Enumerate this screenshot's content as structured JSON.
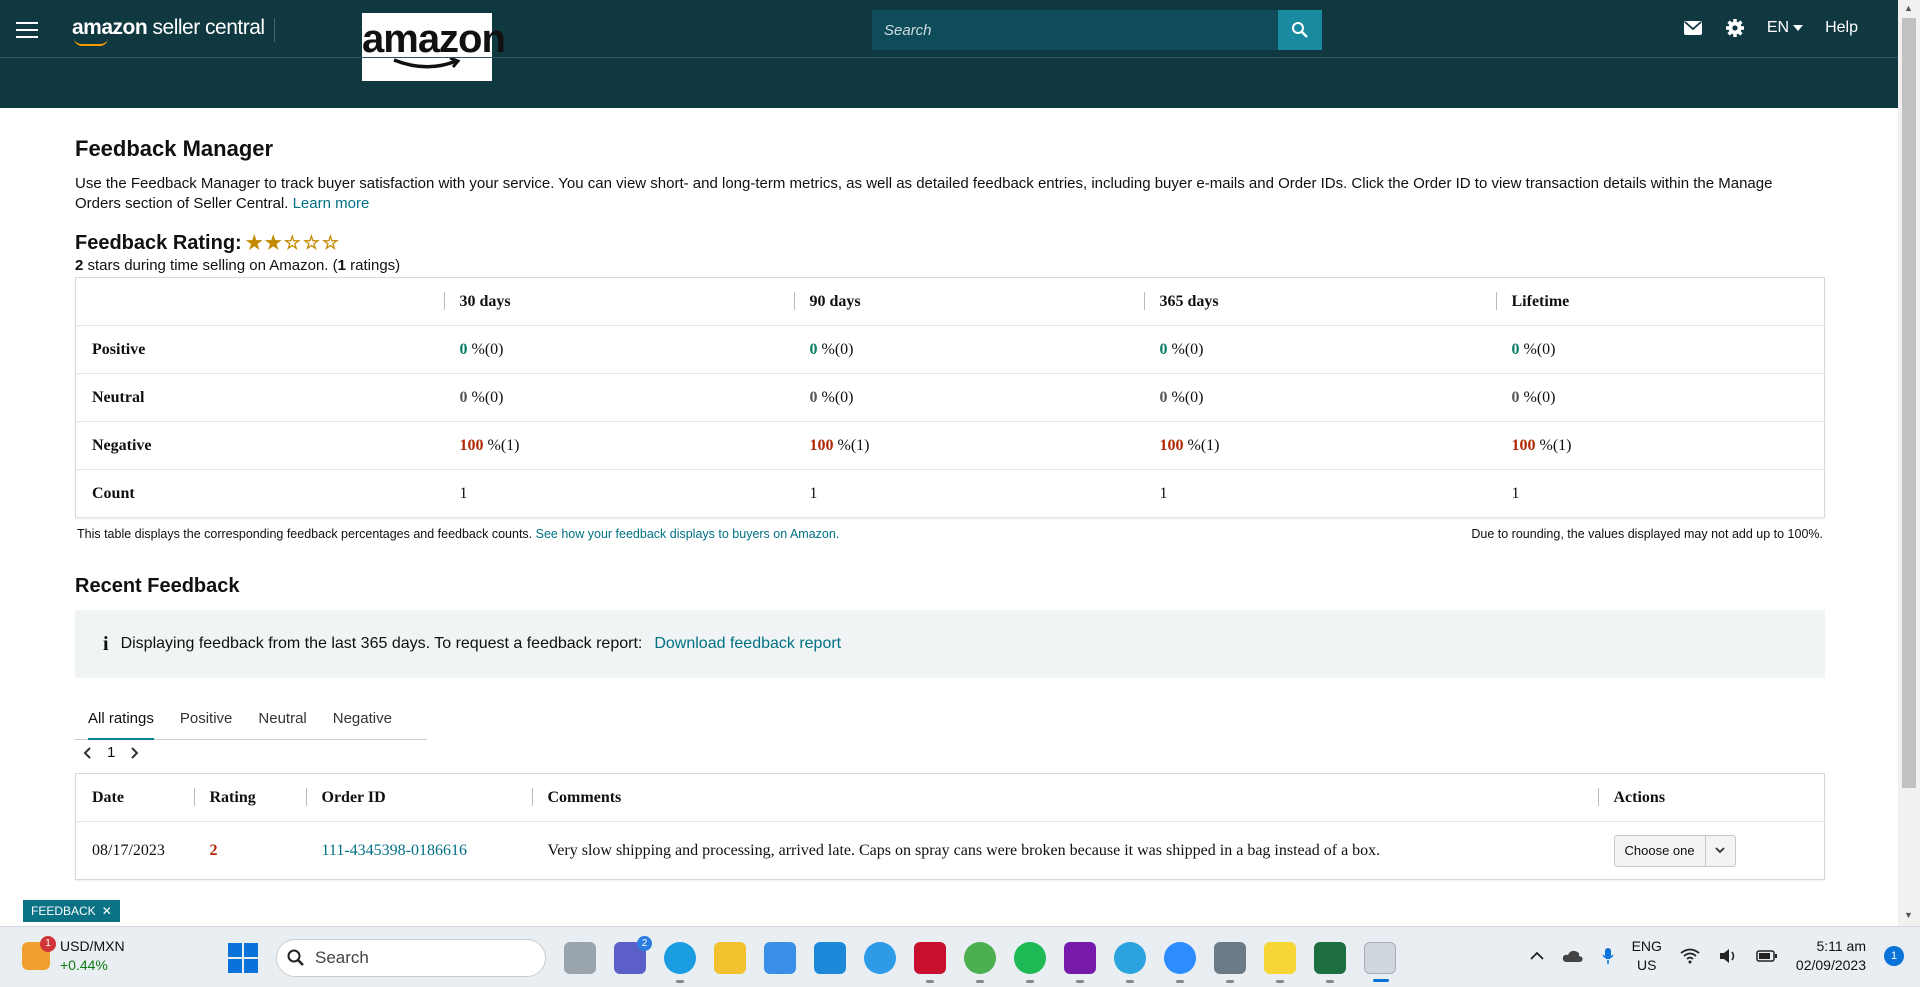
{
  "header": {
    "brand_prefix": "amazon",
    "brand_suffix": "seller central",
    "logo_text": "amazon",
    "search_placeholder": "Search",
    "language": "EN",
    "help": "Help"
  },
  "page": {
    "title": "Feedback Manager",
    "intro": "Use the Feedback Manager to track buyer satisfaction with your service. You can view short- and long-term metrics, as well as detailed feedback entries, including buyer e-mails and Order IDs. Click the Order ID to view transaction details within the Manage Orders section of Seller Central.",
    "learn_more": "Learn more",
    "rating_label": "Feedback Rating:",
    "rating_stars": 2,
    "rating_stars_max": 5,
    "rating_count": "2",
    "rating_sub_text": "stars during time selling on Amazon. (",
    "rating_sub_count": "1",
    "rating_sub_end": "ratings)"
  },
  "metrics": {
    "columns": [
      "30 days",
      "90 days",
      "365 days",
      "Lifetime"
    ],
    "rows": [
      {
        "label": "Positive",
        "cells": [
          {
            "v": "0",
            "r": "%(0)"
          },
          {
            "v": "0",
            "r": "%(0)"
          },
          {
            "v": "0",
            "r": "%(0)"
          },
          {
            "v": "0",
            "r": "%(0)"
          }
        ]
      },
      {
        "label": "Neutral",
        "cells": [
          {
            "v": "0",
            "r": "%(0)"
          },
          {
            "v": "0",
            "r": "%(0)"
          },
          {
            "v": "0",
            "r": "%(0)"
          },
          {
            "v": "0",
            "r": "%(0)"
          }
        ]
      },
      {
        "label": "Negative",
        "cells": [
          {
            "v": "100",
            "r": "%(1)"
          },
          {
            "v": "100",
            "r": "%(1)"
          },
          {
            "v": "100",
            "r": "%(1)"
          },
          {
            "v": "100",
            "r": "%(1)"
          }
        ]
      },
      {
        "label": "Count",
        "cells": [
          {
            "v": "1",
            "r": ""
          },
          {
            "v": "1",
            "r": ""
          },
          {
            "v": "1",
            "r": ""
          },
          {
            "v": "1",
            "r": ""
          }
        ]
      }
    ],
    "note_left": "This table displays the corresponding feedback percentages and feedback counts.",
    "note_link": "See how your feedback displays to buyers on Amazon.",
    "note_right": "Due to rounding, the values displayed may not add up to 100%."
  },
  "recent": {
    "title": "Recent Feedback",
    "info_text": "Displaying feedback from the last 365 days. To request a feedback report:",
    "info_link": "Download feedback report",
    "tabs": [
      "All ratings",
      "Positive",
      "Neutral",
      "Negative"
    ],
    "page": "1",
    "columns": [
      "Date",
      "Rating",
      "Order ID",
      "Comments",
      "Actions"
    ],
    "rows": [
      {
        "date": "08/17/2023",
        "rating": "2",
        "order_id": "111-4345398-0186616",
        "comment": "Very slow shipping and processing, arrived late. Caps on spray cans were broken because it was shipped in a bag instead of a box.",
        "action": "Choose one"
      }
    ]
  },
  "feedback_tab": "FEEDBACK",
  "taskbar": {
    "ticker": "USD/MXN",
    "ticker_change": "+0.44%",
    "weather_badge": "1",
    "search": "Search",
    "teams_badge": "2",
    "lang1": "ENG",
    "lang2": "US",
    "time": "5:11 am",
    "date": "02/09/2023",
    "notifications": "1"
  },
  "colors": {
    "header_bg": "#0f3841",
    "link": "#007185",
    "positive": "#067d62",
    "negative": "#b12704",
    "star": "#c38a00"
  }
}
